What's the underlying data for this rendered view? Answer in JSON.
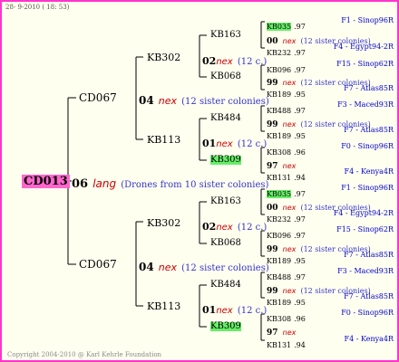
{
  "header_date": "28- 9-2010 ( 18: 53)",
  "footer": "Copyright 2004-2010 @ Karl Kehrle Foundation",
  "root": {
    "id": "CD013",
    "mate_num": "06",
    "race": "lang",
    "note": "(Drones from 10 sister colonies)"
  },
  "level1": [
    {
      "id": "CD067",
      "mate_num": "04",
      "race": "nex",
      "note": "(12 sister colonies)"
    },
    {
      "id": "CD067",
      "mate_num": "04",
      "race": "nex",
      "note": "(12 sister colonies)"
    }
  ],
  "level2": [
    {
      "id": "KB302",
      "mate_num": "02",
      "race": "nex",
      "note": "(12 c.)"
    },
    {
      "id": "KB113",
      "mate_num": "01",
      "race": "nex",
      "note": "(12 c.)"
    },
    {
      "id": "KB302",
      "mate_num": "02",
      "race": "nex",
      "note": "(12 c.)"
    },
    {
      "id": "KB113",
      "mate_num": "01",
      "race": "nex",
      "note": "(12 c.)"
    }
  ],
  "level3": [
    {
      "id": "KB163",
      "mate_num": "00",
      "race": "nex",
      "note": "(12 sister colonies)"
    },
    {
      "id": "KB068",
      "mate_num": "99",
      "race": "nex",
      "note": "(12 sister colonies)"
    },
    {
      "id": "KB484",
      "mate_num": "99",
      "race": "nex",
      "note": "(12 sister colonies)"
    },
    {
      "id": "KB309",
      "mate_num": "97",
      "race": "nex",
      "note": ""
    },
    {
      "id": "KB163",
      "mate_num": "00",
      "race": "nex",
      "note": "(12 sister colonies)"
    },
    {
      "id": "KB068",
      "mate_num": "99",
      "race": "nex",
      "note": "(12 sister colonies)"
    },
    {
      "id": "KB484",
      "mate_num": "99",
      "race": "nex",
      "note": "(12 sister colonies)"
    },
    {
      "id": "KB309",
      "mate_num": "97",
      "race": "nex",
      "note": ""
    }
  ],
  "level4": [
    {
      "id": "KB035",
      "val": ".97",
      "loc": "F1 - Sinop96R"
    },
    {
      "id": "KB232",
      "val": ".97",
      "loc": "F4 - Egypt94-2R"
    },
    {
      "id": "KB096",
      "val": ".97",
      "loc": "F15 - Sinop62R"
    },
    {
      "id": "KB189",
      "val": ".95",
      "loc": "F7 - Atlas85R"
    },
    {
      "id": "KB488",
      "val": ".97",
      "loc": "F3 - Maced93R"
    },
    {
      "id": "KB189",
      "val": ".95",
      "loc": "F7 - Atlas85R"
    },
    {
      "id": "KB308",
      "val": ".96",
      "loc": "F0 - Sinop96R"
    },
    {
      "id": "KB131",
      "val": ".94",
      "loc": "F4 - Kenya4R"
    },
    {
      "id": "KB035",
      "val": ".97",
      "loc": "F1 - Sinop96R"
    },
    {
      "id": "KB232",
      "val": ".97",
      "loc": "F4 - Egypt94-2R"
    },
    {
      "id": "KB096",
      "val": ".97",
      "loc": "F15 - Sinop62R"
    },
    {
      "id": "KB189",
      "val": ".95",
      "loc": "F7 - Atlas85R"
    },
    {
      "id": "KB488",
      "val": ".97",
      "loc": "F3 - Maced93R"
    },
    {
      "id": "KB189",
      "val": ".95",
      "loc": "F7 - Atlas85R"
    },
    {
      "id": "KB308",
      "val": ".96",
      "loc": "F0 - Sinop96R"
    },
    {
      "id": "KB131",
      "val": ".94",
      "loc": "F4 - Kenya4R"
    }
  ],
  "colors": {
    "border": "#ff33cc",
    "root_highlight": "#ff66cc",
    "green_highlight": "#66ee66",
    "race": "#cc0000",
    "note": "#3333cc",
    "location": "#0000cc"
  }
}
